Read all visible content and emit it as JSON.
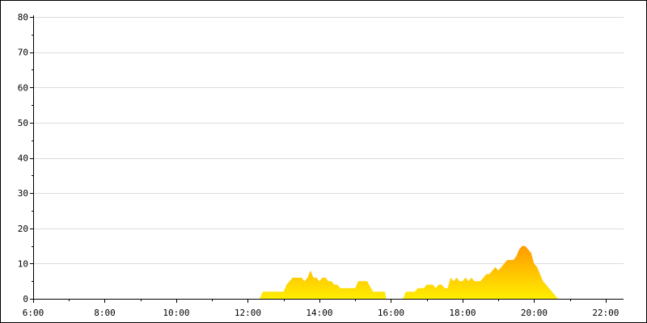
{
  "chart_data": {
    "type": "area",
    "title": "",
    "xlabel": "",
    "ylabel": "",
    "xlim": [
      "6:00",
      "22:30"
    ],
    "ylim": [
      0,
      80
    ],
    "grid": true,
    "legend": "none",
    "y_ticks": [
      0,
      10,
      20,
      30,
      40,
      50,
      60,
      70,
      80
    ],
    "x_ticks": [
      "6:00",
      "8:00",
      "10:00",
      "12:00",
      "14:00",
      "16:00",
      "18:00",
      "20:00",
      "22:00"
    ],
    "colors": {
      "low": "#ffee00",
      "high": "#ff9900",
      "grid": "#dcdcdc",
      "axis": "#000000"
    },
    "segments": [
      {
        "x": [
          "12:20",
          "12:25",
          "12:30",
          "12:40",
          "12:50",
          "13:00",
          "13:05",
          "13:10",
          "13:15",
          "13:20",
          "13:25",
          "13:30",
          "13:35",
          "13:40",
          "13:45",
          "13:50",
          "13:55",
          "14:00",
          "14:05",
          "14:10",
          "14:15",
          "14:20",
          "14:25",
          "14:30",
          "14:35",
          "14:40",
          "14:45",
          "14:50",
          "14:55",
          "15:00",
          "15:05",
          "15:10",
          "15:20",
          "15:30",
          "15:40",
          "15:50"
        ],
        "values": [
          0,
          2,
          2,
          2,
          2,
          2,
          4,
          5,
          6,
          6,
          6,
          6,
          5,
          6,
          8,
          6,
          6,
          5,
          6,
          6,
          5,
          5,
          4,
          4,
          3,
          3,
          3,
          3,
          3,
          3,
          5,
          5,
          5,
          2,
          2,
          2
        ]
      },
      {
        "x": [
          "15:50",
          "15:52"
        ],
        "values": [
          2,
          0
        ]
      },
      {
        "x": [
          "16:20",
          "16:25",
          "16:30",
          "16:40",
          "16:45",
          "16:50",
          "16:55",
          "17:00",
          "17:05",
          "17:10",
          "17:15",
          "17:20",
          "17:25",
          "17:30",
          "17:35",
          "17:40",
          "17:45",
          "17:50",
          "17:55",
          "18:00",
          "18:05",
          "18:10",
          "18:15",
          "18:20",
          "18:25",
          "18:30",
          "18:35",
          "18:40",
          "18:45",
          "18:50",
          "18:55",
          "19:00",
          "19:05",
          "19:10",
          "19:15",
          "19:20",
          "19:25",
          "19:30",
          "19:35",
          "19:40",
          "19:45",
          "19:50",
          "19:55",
          "20:00",
          "20:05",
          "20:10",
          "20:15",
          "20:20",
          "20:25",
          "20:30",
          "20:35",
          "20:40"
        ],
        "values": [
          0,
          2,
          2,
          2,
          3,
          3,
          3,
          4,
          4,
          4,
          3,
          4,
          4,
          3,
          3,
          6,
          5,
          6,
          5,
          5,
          6,
          5,
          6,
          5,
          5,
          5,
          6,
          7,
          7,
          8,
          9,
          8,
          9,
          10,
          11,
          11,
          11,
          12,
          14,
          15,
          15,
          14,
          13,
          10,
          9,
          7,
          5,
          4,
          3,
          2,
          1,
          0
        ]
      }
    ]
  }
}
